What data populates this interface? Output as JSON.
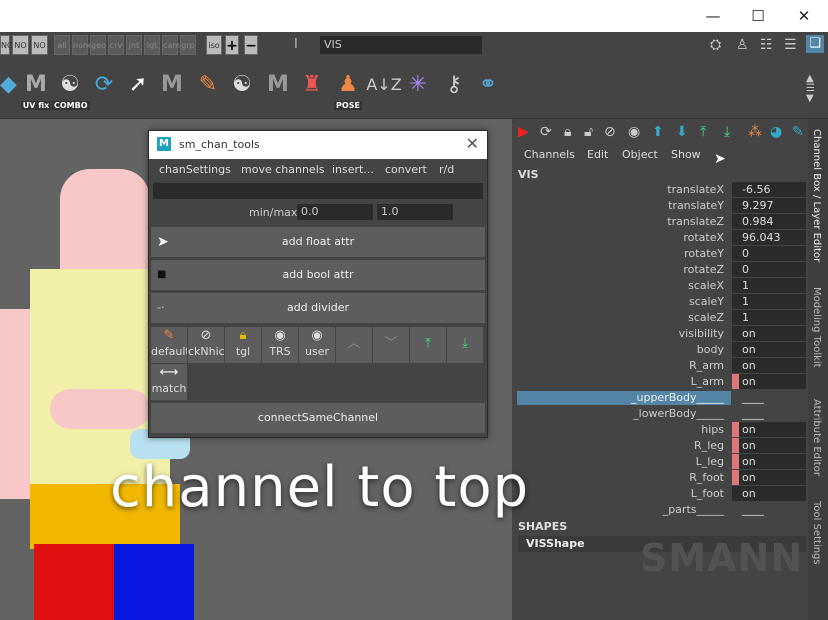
{
  "window_controls": {
    "minimize": "—",
    "maximize": "☐",
    "close": "✕"
  },
  "selection_masks": [
    "NO",
    "NO",
    "NO",
    "all",
    "none",
    "geo",
    "crv",
    "jnt",
    "lgt",
    "cam",
    "grp",
    "iso"
  ],
  "object_field": {
    "value": "VIS",
    "icon": "text-cursor-icon"
  },
  "shelf": {
    "uvfix_label": "UV fix",
    "combo_label": "COMBO",
    "pose_label": "POSE"
  },
  "viewport": {
    "caption": "channel to top"
  },
  "tool_window": {
    "title": "sm_chan_tools",
    "logo": "M",
    "close": "✕",
    "menu": [
      "chanSettings",
      "move channels",
      "insert...",
      "convert",
      "r/d"
    ],
    "minmax_label": "min/max",
    "min_value": "0.0",
    "max_value": "1.0",
    "buttons": {
      "add_float": "add float attr",
      "add_bool": "add bool attr",
      "add_divider": "add divider",
      "connect": "connectSameChannel"
    },
    "icon_buttons": [
      {
        "name": "default",
        "icon": "pencil-icon"
      },
      {
        "name": "ckNhic",
        "icon": "eye-slash-icon"
      },
      {
        "name": "tgl",
        "icon": "lock-icon"
      },
      {
        "name": "TRS",
        "icon": "eye-icon"
      },
      {
        "name": "user",
        "icon": "eye-icon"
      }
    ],
    "match_label": "match"
  },
  "channel_box": {
    "menu": [
      "Channels",
      "Edit",
      "Object",
      "Show"
    ],
    "object_name": "VIS",
    "attributes": [
      {
        "label": "translateX",
        "value": "-6.56"
      },
      {
        "label": "translateY",
        "value": "9.297"
      },
      {
        "label": "translateZ",
        "value": "0.984"
      },
      {
        "label": "rotateX",
        "value": "96.043"
      },
      {
        "label": "rotateY",
        "value": "0"
      },
      {
        "label": "rotateZ",
        "value": "0"
      },
      {
        "label": "scaleX",
        "value": "1"
      },
      {
        "label": "scaleY",
        "value": "1"
      },
      {
        "label": "scaleZ",
        "value": "1"
      },
      {
        "label": "visibility",
        "value": "on"
      },
      {
        "label": "body",
        "value": "on"
      },
      {
        "label": "R_arm",
        "value": "on"
      },
      {
        "label": "L_arm",
        "value": "on",
        "keyed": true
      },
      {
        "label": "_upperBody_____",
        "value": "____",
        "selected": true
      },
      {
        "label": "_lowerBody_____",
        "value": "____"
      },
      {
        "label": "hips",
        "value": "on",
        "keyed": true
      },
      {
        "label": "R_leg",
        "value": "on",
        "keyed": true
      },
      {
        "label": "L_leg",
        "value": "on",
        "keyed": true
      },
      {
        "label": "R_foot",
        "value": "on",
        "keyed": true
      },
      {
        "label": "L_foot",
        "value": "on"
      },
      {
        "label": "_parts_____",
        "value": "____"
      }
    ],
    "shapes_header": "SHAPES",
    "shape_item": "VISShape",
    "watermark": "SMANN"
  },
  "side_tabs": [
    "Channel Box / Layer Editor",
    "Modeling Toolkit",
    "Attribute Editor",
    "Tool Settings"
  ]
}
